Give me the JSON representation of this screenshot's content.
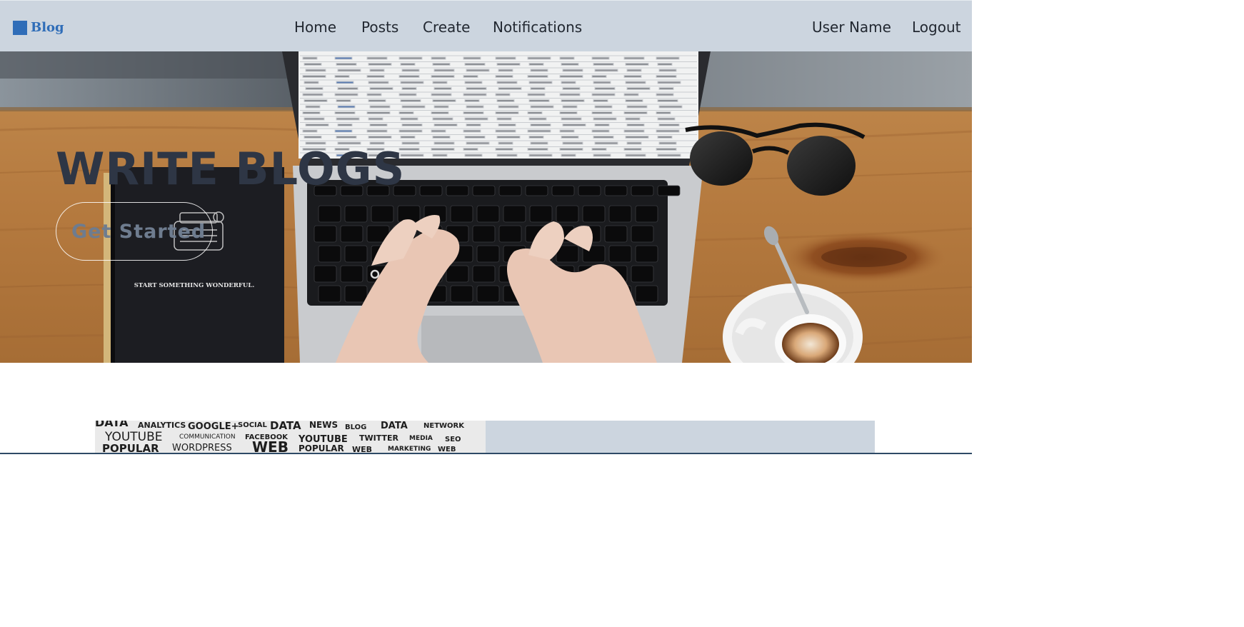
{
  "brand": {
    "name": "Blog",
    "color": "#2f6db8"
  },
  "nav": {
    "home": "Home",
    "posts": "Posts",
    "create": "Create",
    "notifications": "Notifications",
    "user_name": "User Name",
    "logout": "Logout"
  },
  "hero": {
    "title": "WRITE BLOGS",
    "cta_label": "Get Started",
    "notebook_caption": "START SOMETHING WONDERFUL."
  },
  "colors": {
    "navbar_bg": "#ccd5df",
    "title_text": "#2e3645",
    "divider": "#2e4a66"
  }
}
